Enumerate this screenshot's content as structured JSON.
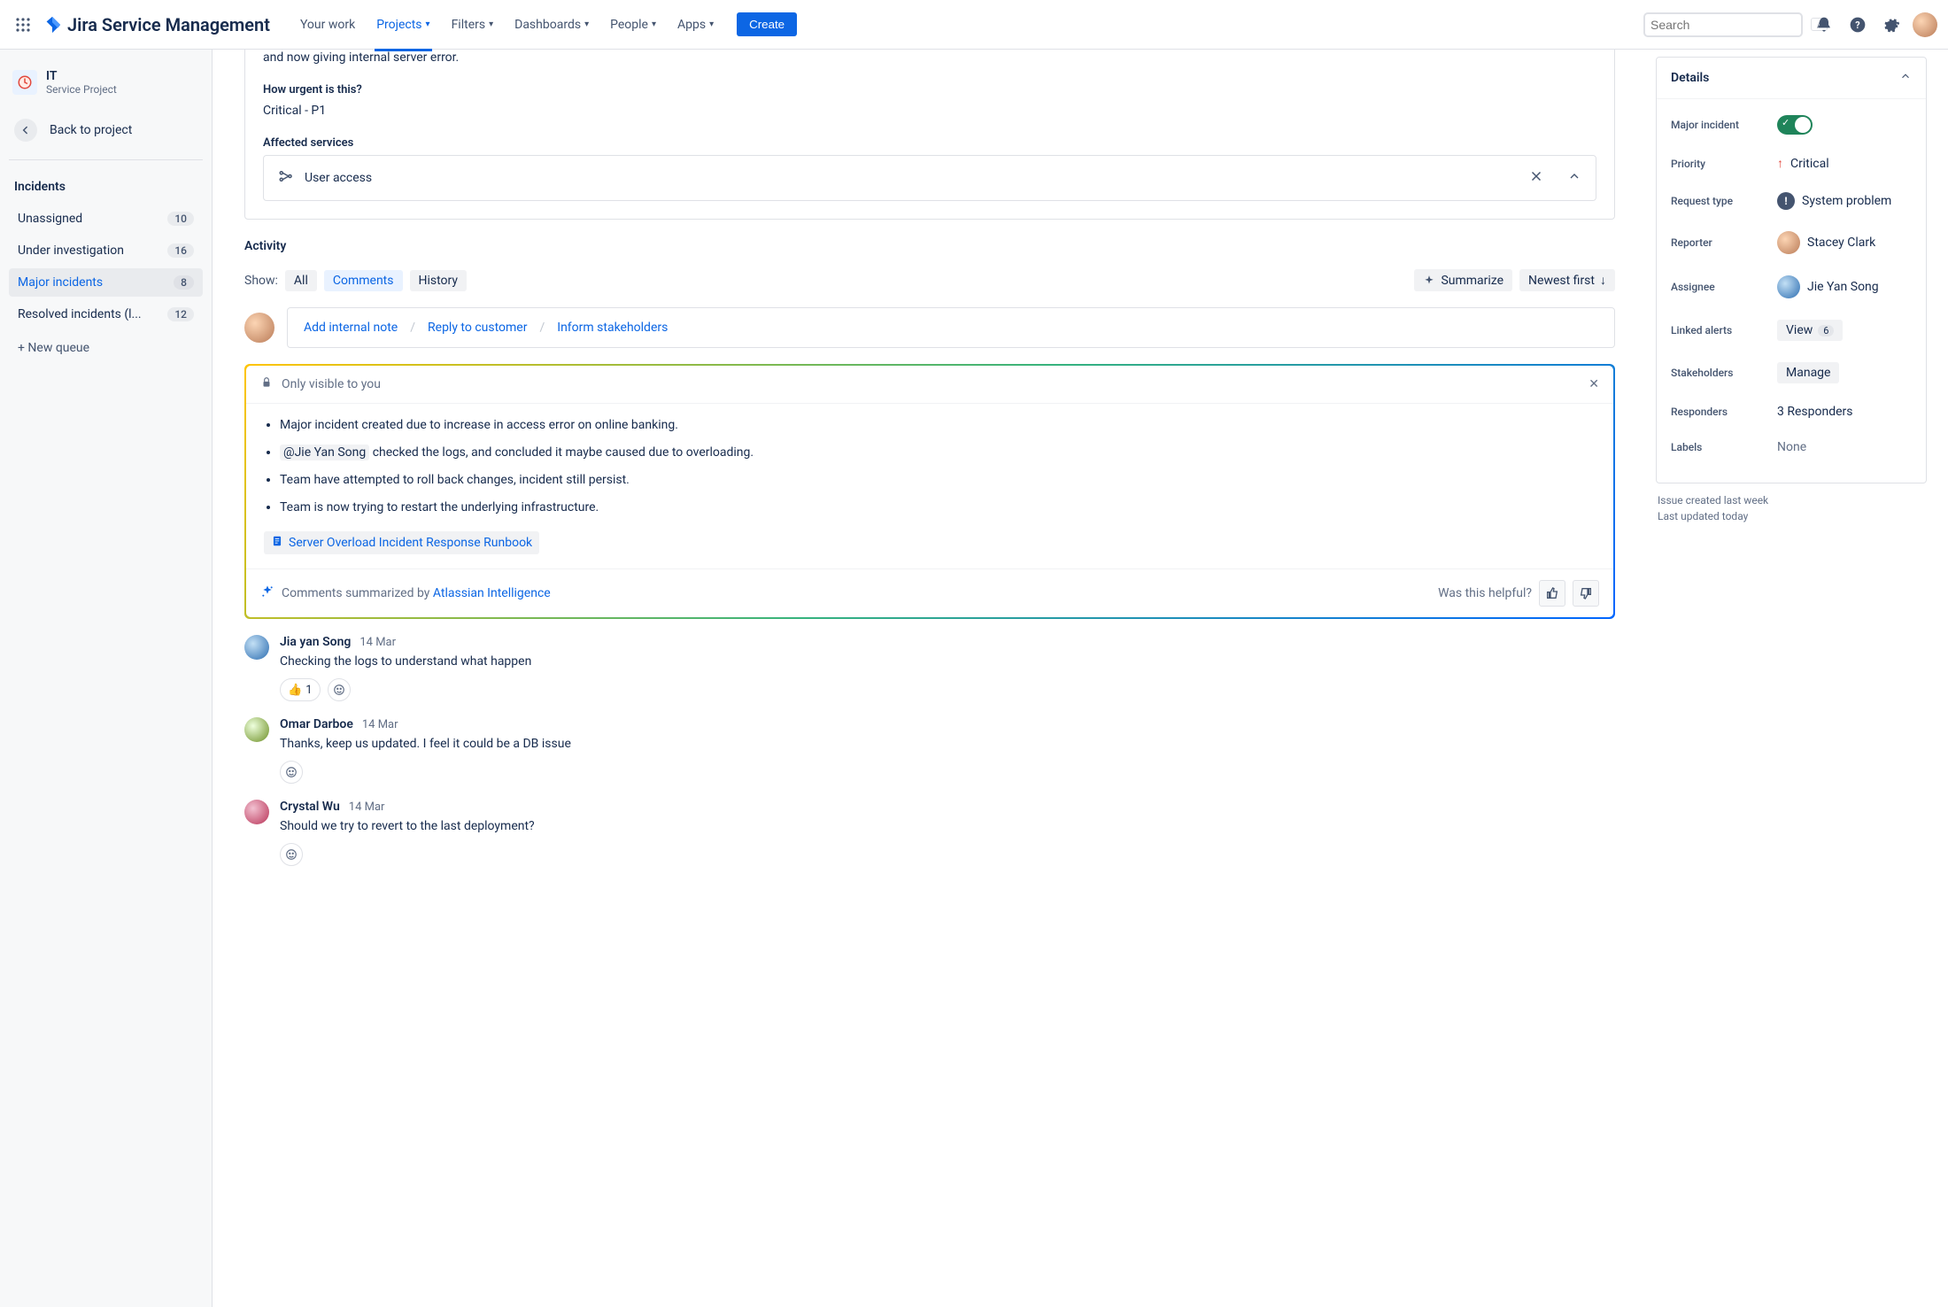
{
  "topnav": {
    "product": "Jira Service Management",
    "links": {
      "your_work": "Your work",
      "projects": "Projects",
      "filters": "Filters",
      "dashboards": "Dashboards",
      "people": "People",
      "apps": "Apps"
    },
    "create": "Create",
    "search_placeholder": "Search",
    "kbd": "/"
  },
  "sidebar": {
    "project_name": "IT",
    "project_type": "Service Project",
    "back": "Back to project",
    "section": "Incidents",
    "items": [
      {
        "label": "Unassigned",
        "count": "10"
      },
      {
        "label": "Under investigation",
        "count": "16"
      },
      {
        "label": "Major incidents",
        "count": "8"
      },
      {
        "label": "Resolved incidents (l...",
        "count": "12"
      }
    ],
    "new_queue": "+ New queue"
  },
  "issue": {
    "desc_continuation": "and now giving internal server error.",
    "urgency_q": "How urgent is this?",
    "urgency_a": "Critical - P1",
    "affected_label": "Affected services",
    "service": "User access"
  },
  "activity": {
    "title": "Activity",
    "show_label": "Show:",
    "tabs": {
      "all": "All",
      "comments": "Comments",
      "history": "History"
    },
    "summarize": "Summarize",
    "newest_first": "Newest first",
    "reply": {
      "internal": "Add internal note",
      "customer": "Reply to customer",
      "stakeholders": "Inform stakeholders"
    }
  },
  "ai": {
    "visibility": "Only visible to you",
    "bullets": [
      "Major incident created due to increase in access error on online banking.",
      {
        "mention": "@Jie Yan Song",
        "rest": "checked the logs, and concluded it maybe caused due to overloading."
      },
      "Team have attempted to roll back changes, incident still persist.",
      "Team is now trying to restart the underlying infrastructure."
    ],
    "runbook": "Server Overload Incident Response Runbook",
    "footer_prefix": "Comments summarized by",
    "footer_link": "Atlassian Intelligence",
    "helpful": "Was this helpful?"
  },
  "comments": [
    {
      "author": "Jia yan Song",
      "date": "14 Mar",
      "text": "Checking the logs to understand what happen",
      "react": "👍",
      "react_count": "1"
    },
    {
      "author": "Omar Darboe",
      "date": "14 Mar",
      "text": "Thanks, keep us updated. I feel it could be a DB issue"
    },
    {
      "author": "Crystal Wu",
      "date": "14 Mar",
      "text": "Should we try to revert to the last deployment?"
    }
  ],
  "details": {
    "title": "Details",
    "rows": {
      "major_incident": "Major incident",
      "priority": {
        "label": "Priority",
        "value": "Critical"
      },
      "request_type": {
        "label": "Request type",
        "value": "System problem"
      },
      "reporter": {
        "label": "Reporter",
        "value": "Stacey Clark"
      },
      "assignee": {
        "label": "Assignee",
        "value": "Jie Yan Song"
      },
      "linked_alerts": {
        "label": "Linked alerts",
        "value": "View",
        "count": "6"
      },
      "stakeholders": {
        "label": "Stakeholders",
        "value": "Manage"
      },
      "responders": {
        "label": "Responders",
        "value": "3 Responders"
      },
      "labels": {
        "label": "Labels",
        "value": "None"
      }
    },
    "meta1": "Issue created last week",
    "meta2": "Last updated today"
  }
}
